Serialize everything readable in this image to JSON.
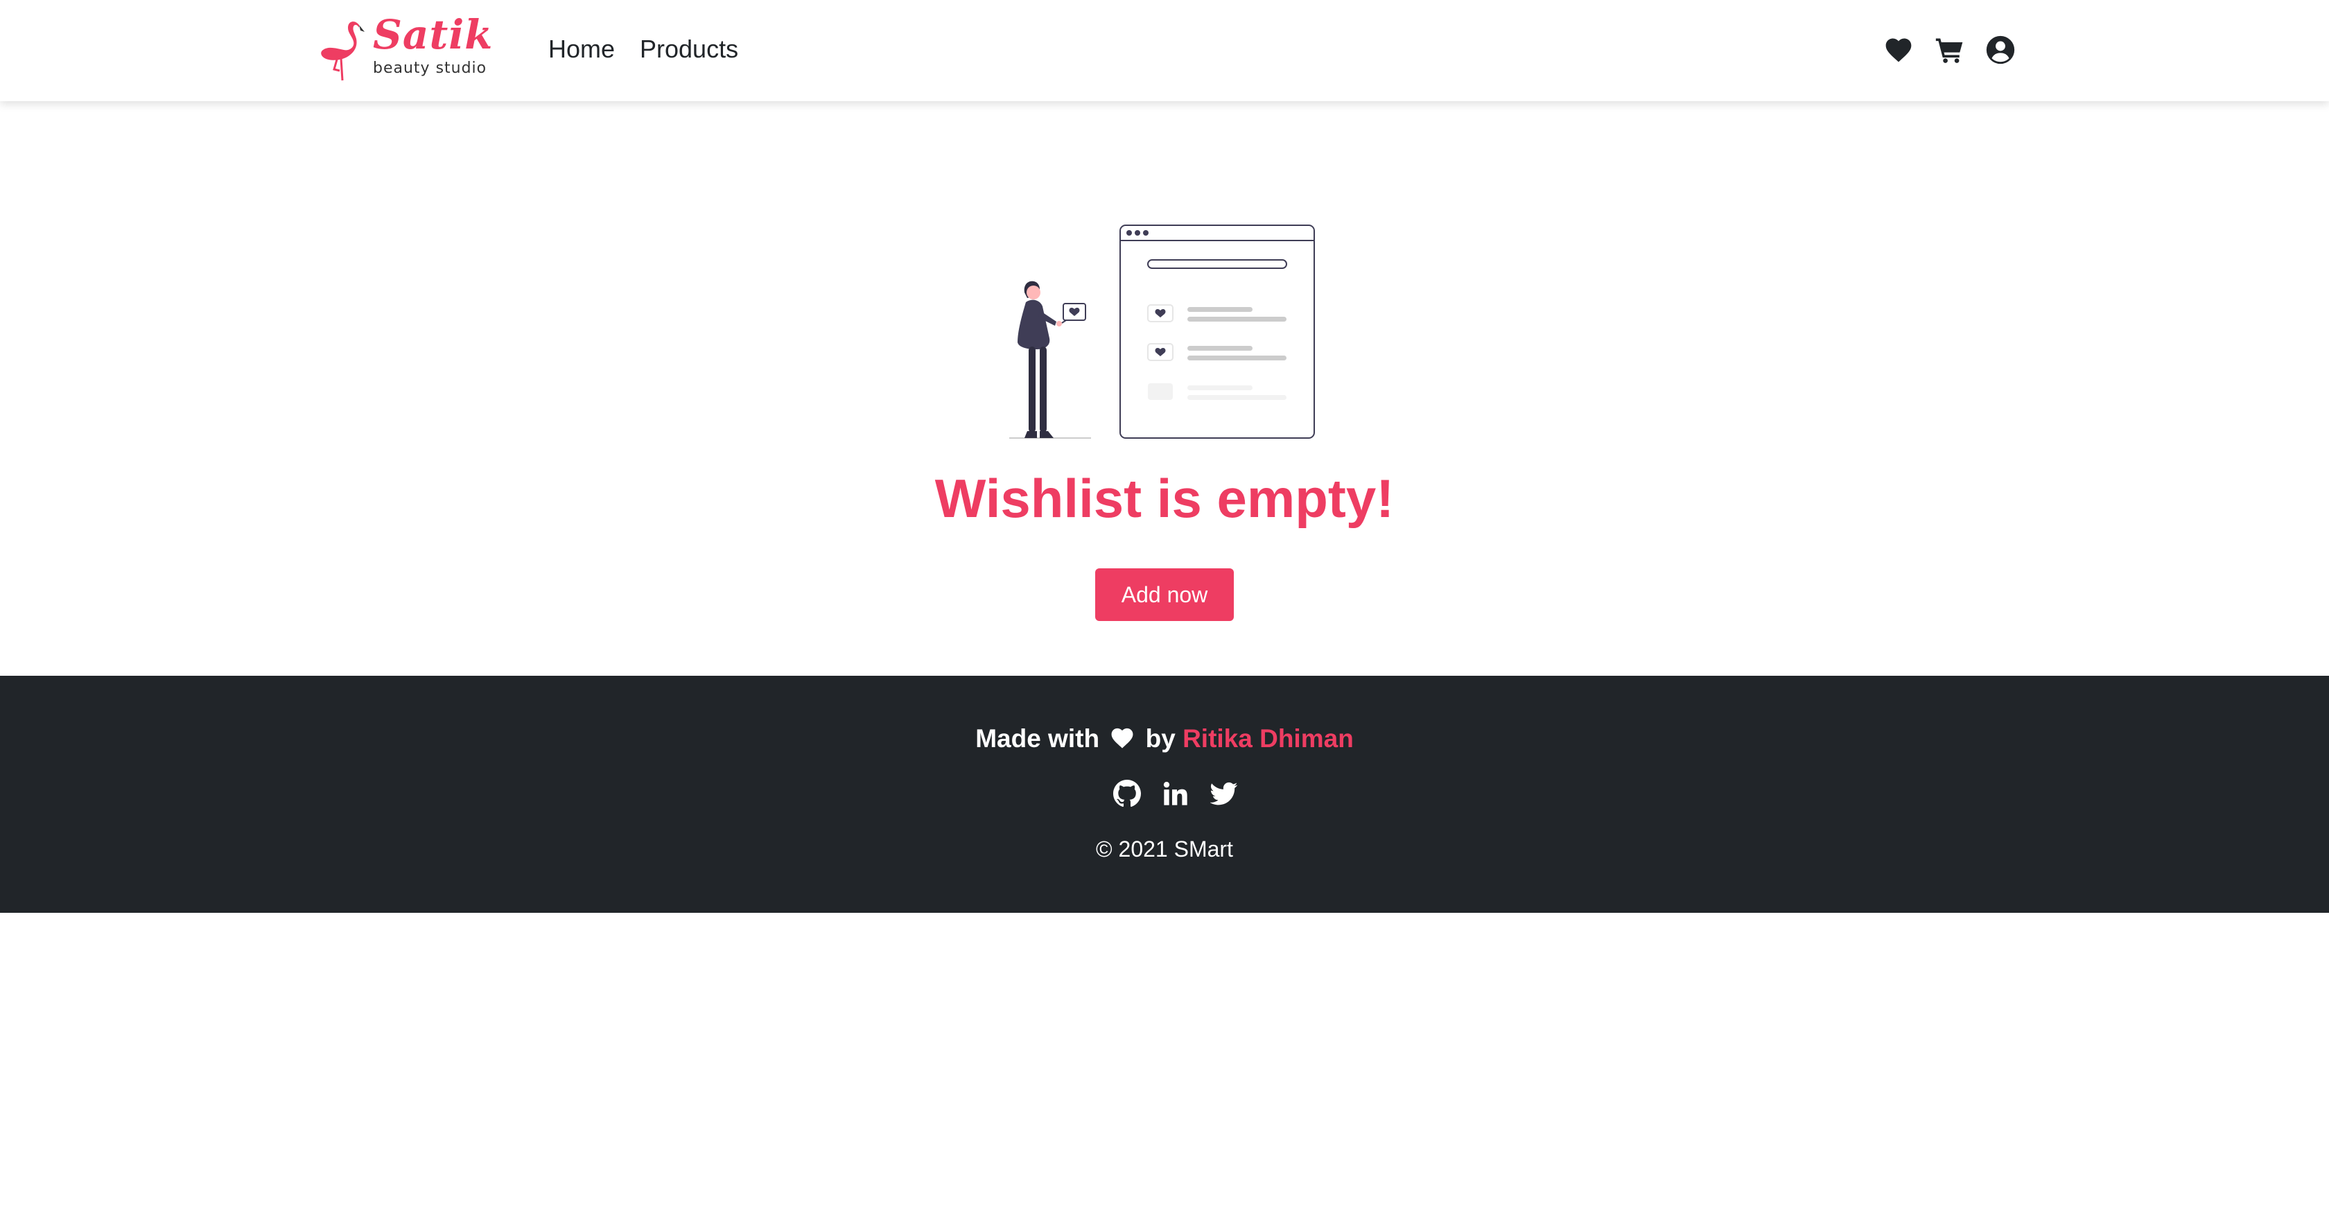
{
  "colors": {
    "accent": "#ee3d62",
    "footer_bg": "#212529",
    "text": "#212529"
  },
  "navbar": {
    "brand": {
      "name": "Satik",
      "tagline": "beauty studio",
      "logo_icon": "flamingo-logo"
    },
    "links": [
      "Home",
      "Products"
    ],
    "icons": [
      "wishlist-heart-icon",
      "cart-icon",
      "user-account-icon"
    ]
  },
  "empty_state": {
    "illustration": "woman-with-wishlist-window-illustration",
    "title": "Wishlist is empty!",
    "button_label": "Add now"
  },
  "footer": {
    "made_with": "Made with",
    "by": "by",
    "author": "Ritika Dhiman",
    "social_icons": [
      "github-icon",
      "linkedin-icon",
      "twitter-icon"
    ],
    "copyright": "© 2021 SMart"
  }
}
